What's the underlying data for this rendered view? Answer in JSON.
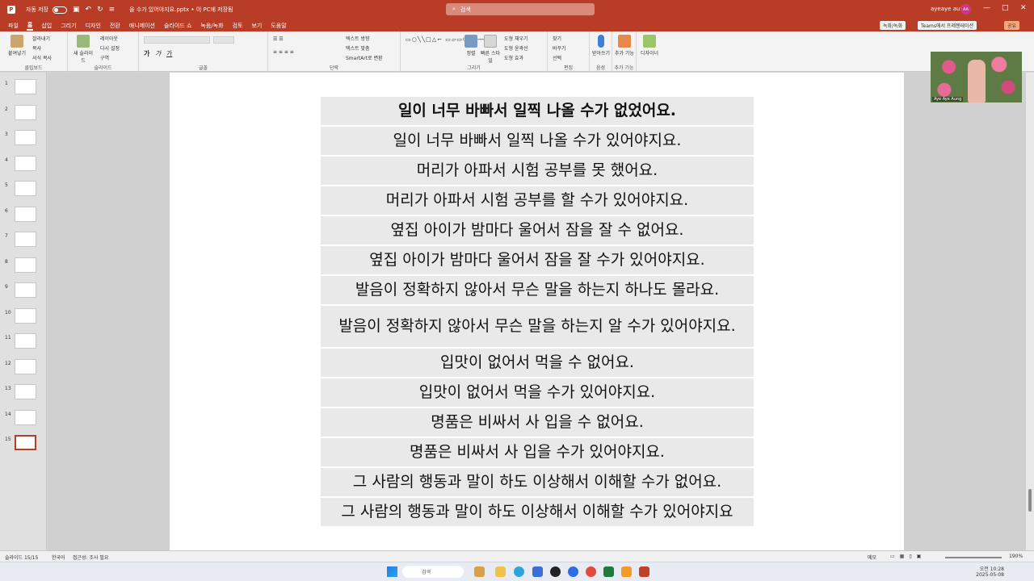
{
  "titlebar": {
    "autosave": "자동 저장",
    "filename": "을 수가 있어야지요.pptx • 이 PC에 저장됨",
    "search_placeholder": "검색",
    "user_name": "ayeaye aung",
    "avatar_initials": "AA"
  },
  "menu": {
    "tabs": [
      "파일",
      "홈",
      "삽입",
      "그리기",
      "디자인",
      "전환",
      "애니메이션",
      "슬라이드 쇼",
      "녹음/녹화",
      "검토",
      "보기",
      "도움말"
    ],
    "record_btn": "녹화/녹화",
    "teams_btn": "Teams에서 프레젠테이션",
    "share_btn": "공유"
  },
  "ribbon": {
    "paste": "붙여넣기",
    "cut": "잘라내기",
    "copy": "복사",
    "format_copy": "서식 복사",
    "clipboard": "클립보드",
    "new_slide": "새 슬라이드",
    "layout": "레이아웃",
    "reset": "다시 설정",
    "section": "구역",
    "slides": "슬라이드",
    "font": "글꼴",
    "paragraph": "단락",
    "text_direction": "텍스트 방향",
    "text_align": "텍스트 맞춤",
    "smartart": "SmartArt로 변환",
    "drawing": "그리기",
    "arrange": "정렬",
    "quick_styles": "빠른 스타일",
    "shape_fill": "도형 채우기",
    "shape_outline": "도형 윤곽선",
    "shape_effects": "도형 효과",
    "find": "찾기",
    "replace": "바꾸기",
    "select": "선택",
    "editing": "편집",
    "dictate": "받아쓰기",
    "voice": "음성",
    "addins": "추가 기능",
    "addins_group": "추가 기능",
    "designer": "디자이너"
  },
  "slides_panel": {
    "numbers": [
      "1",
      "2",
      "3",
      "4",
      "5",
      "6",
      "7",
      "8",
      "9",
      "10",
      "11",
      "12",
      "13",
      "14",
      "15"
    ],
    "active": 15
  },
  "slide": {
    "rows": [
      "일이 너무 바빠서 일찍 나올 수가 없었어요.",
      "일이 너무 바빠서 일찍 나올 수가 있어야지요.",
      "머리가 아파서 시험 공부를 못 했어요.",
      "머리가 아파서 시험 공부를 할 수가 있어야지요.",
      "옆집 아이가 밤마다 울어서 잠을 잘 수 없어요.",
      "옆집 아이가 밤마다 울어서 잠을 잘 수가 있어야지요.",
      "발음이 정확하지 않아서 무슨 말을 하는지 하나도 몰라요.",
      "발음이 정확하지 않아서 무슨 말을 하는지 알 수가 있어야지요.",
      "입맛이 없어서 먹을 수 없어요.",
      "입맛이 없어서 먹을 수가 있어야지요.",
      "명품은 비싸서 사 입을 수 없어요.",
      "명품은 비싸서 사 입을 수가 있어야지요.",
      "그 사람의 행동과 말이 하도 이상해서 이해할 수가 없어요.",
      "그 사람의 행동과 말이 하도 이상해서 이해할 수가 있어야지요"
    ]
  },
  "video": {
    "name": "Aye Aye Aung"
  },
  "statusbar": {
    "slide_info": "슬라이드 15/15",
    "language": "한국어",
    "accessibility": "접근성: 조사 필요",
    "notes": "메모",
    "zoom": "190%"
  },
  "taskbar": {
    "search": "검색",
    "time": "오전 10:28",
    "date": "2025-05-08"
  },
  "colors": {
    "accent": "#b83c26",
    "slide_row_bg": "#e9e9e9"
  }
}
